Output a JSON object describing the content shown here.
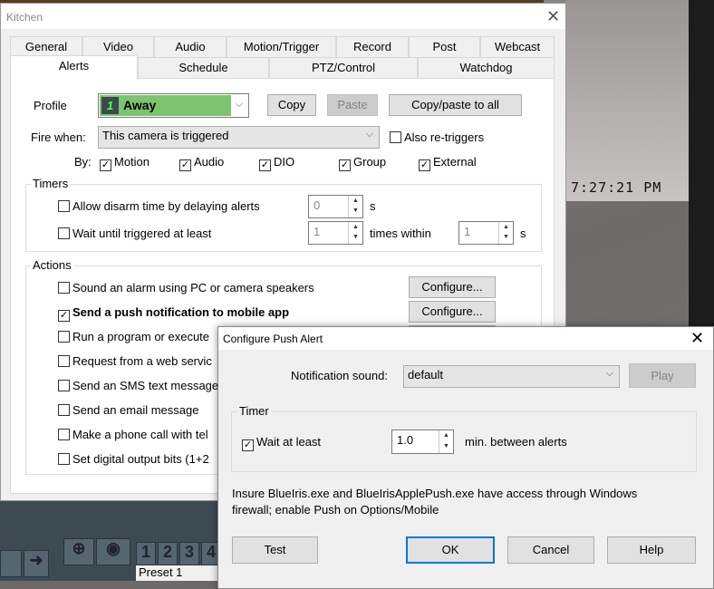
{
  "camera": {
    "timestamp": "7:27:21 PM"
  },
  "main_dialog": {
    "title": "Kitchen",
    "tabs_row1": [
      "General",
      "Video",
      "Audio",
      "Motion/Trigger",
      "Record",
      "Post",
      "Webcast"
    ],
    "tabs_row2": [
      "Alerts",
      "Schedule",
      "PTZ/Control",
      "Watchdog"
    ],
    "active_tab": "Alerts",
    "profile": {
      "label": "Profile",
      "number": "1",
      "value": "Away",
      "color": "#7dc46e"
    },
    "buttons": {
      "copy": "Copy",
      "paste": "Paste",
      "copy_all": "Copy/paste to all"
    },
    "fire_when": {
      "label": "Fire when:",
      "value": "This camera is triggered",
      "also": "Also re-triggers",
      "also_checked": false
    },
    "by": {
      "label": "By:",
      "items": [
        {
          "label": "Motion",
          "checked": true
        },
        {
          "label": "Audio",
          "checked": true
        },
        {
          "label": "DIO",
          "checked": true
        },
        {
          "label": "Group",
          "checked": true
        },
        {
          "label": "External",
          "checked": true
        }
      ]
    },
    "timers": {
      "title": "Timers",
      "disarm": {
        "label": "Allow disarm time by delaying alerts",
        "value": "0",
        "unit": "s",
        "checked": false
      },
      "wait": {
        "label": "Wait until triggered at least",
        "value": "1",
        "mid": "times within",
        "value2": "1",
        "unit": "s",
        "checked": false
      }
    },
    "actions": {
      "title": "Actions",
      "configure": "Configure...",
      "items": [
        {
          "label": "Sound an alarm using PC or camera speakers",
          "checked": false
        },
        {
          "label": "Send a push notification to mobile app",
          "checked": true
        },
        {
          "label": "Run a program or execute",
          "checked": false
        },
        {
          "label": "Request from a web servic",
          "checked": false
        },
        {
          "label": "Send an SMS text message",
          "checked": false
        },
        {
          "label": "Send an email message",
          "checked": false
        },
        {
          "label": "Make a phone call with tel",
          "checked": false
        },
        {
          "label": "Set digital output bits (1+2",
          "checked": false
        }
      ]
    }
  },
  "push_dialog": {
    "title": "Configure Push Alert",
    "sound_label": "Notification sound:",
    "sound_value": "default",
    "play": "Play",
    "timer_title": "Timer",
    "wait_label": "Wait at least",
    "wait_checked": true,
    "wait_value": "1.0",
    "wait_unit": "min. between alerts",
    "note1": "Insure BlueIris.exe and BlueIrisApplePush.exe have access through Windows",
    "note2": "firewall; enable Push on Options/Mobile",
    "buttons": {
      "test": "Test",
      "ok": "OK",
      "cancel": "Cancel",
      "help": "Help"
    }
  },
  "toolbar": {
    "presets": [
      "1",
      "2",
      "3",
      "4"
    ],
    "preset_value": "Preset 1"
  }
}
